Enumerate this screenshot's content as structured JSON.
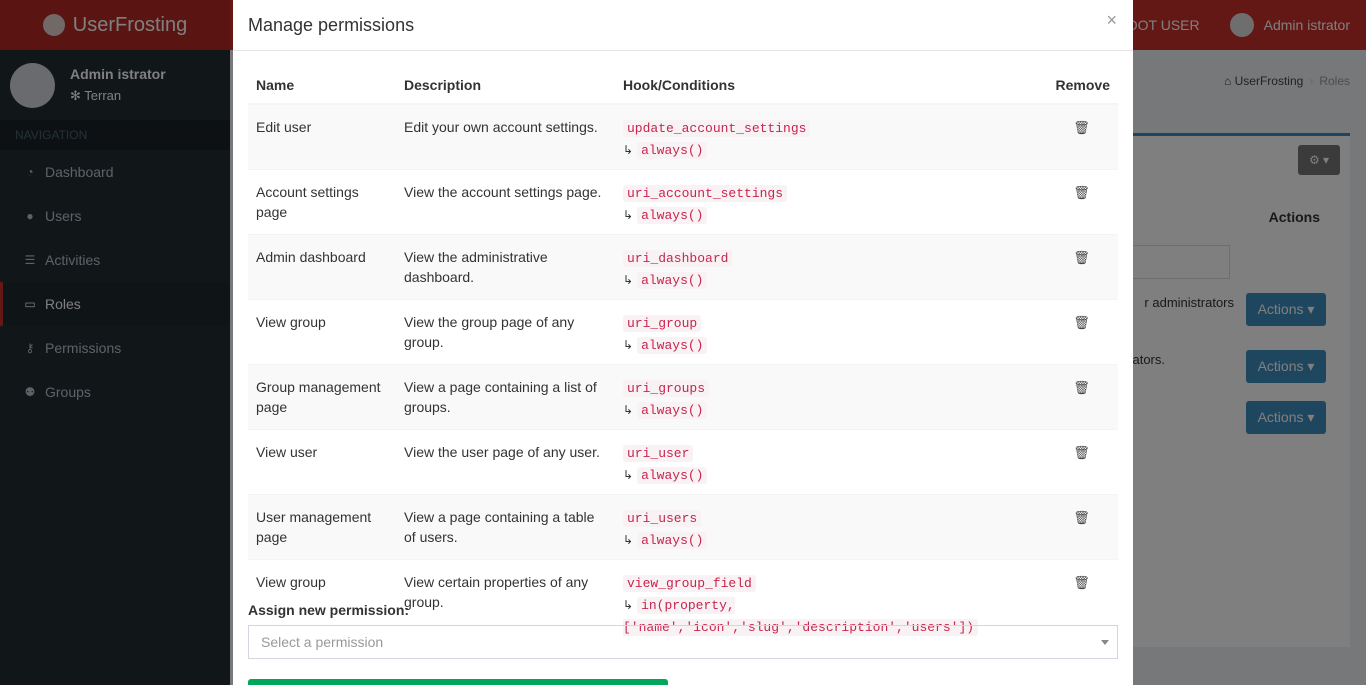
{
  "app": {
    "brand": "UserFrosting"
  },
  "topbar": {
    "root_label": "ROOT USER",
    "user_name": "Admin istrator"
  },
  "sidebar": {
    "user_name": "Admin istrator",
    "user_status": "Terran",
    "nav_header": "NAVIGATION",
    "items": [
      {
        "label": "Dashboard",
        "icon": "dashboard-icon",
        "glyph": "◔"
      },
      {
        "label": "Users",
        "icon": "user-icon",
        "glyph": "●"
      },
      {
        "label": "Activities",
        "icon": "list-icon",
        "glyph": "☰"
      },
      {
        "label": "Roles",
        "icon": "id-card-icon",
        "glyph": "▭"
      },
      {
        "label": "Permissions",
        "icon": "key-icon",
        "glyph": "⚷"
      },
      {
        "label": "Groups",
        "icon": "users-icon",
        "glyph": "⚉"
      }
    ]
  },
  "breadcrumb": {
    "home": "UserFrosting",
    "current": "Roles"
  },
  "background_table": {
    "actions_header": "Actions",
    "row1_text": "r administrators",
    "row2_text": "rators.",
    "action_label": "Actions ▾"
  },
  "modal": {
    "title": "Manage permissions",
    "close": "×",
    "columns": {
      "name": "Name",
      "description": "Description",
      "hook": "Hook/Conditions",
      "remove": "Remove"
    },
    "rows": [
      {
        "name": "Edit user",
        "description": "Edit your own account settings.",
        "hook": "update_account_settings",
        "condition": "always()"
      },
      {
        "name": "Account settings page",
        "description": "View the account settings page.",
        "hook": "uri_account_settings",
        "condition": "always()"
      },
      {
        "name": "Admin dashboard",
        "description": "View the administrative dashboard.",
        "hook": "uri_dashboard",
        "condition": "always()"
      },
      {
        "name": "View group",
        "description": "View the group page of any group.",
        "hook": "uri_group",
        "condition": "always()"
      },
      {
        "name": "Group management page",
        "description": "View a page containing a list of groups.",
        "hook": "uri_groups",
        "condition": "always()"
      },
      {
        "name": "View user",
        "description": "View the user page of any user.",
        "hook": "uri_user",
        "condition": "always()"
      },
      {
        "name": "User management page",
        "description": "View a page containing a table of users.",
        "hook": "uri_users",
        "condition": "always()"
      },
      {
        "name": "View group",
        "description": "View certain properties of any group.",
        "hook": "view_group_field",
        "condition": "in(property,['name','icon','slug','description','users'])"
      }
    ],
    "assign_label": "Assign new permission:",
    "select_placeholder": "Select a permission"
  },
  "colors": {
    "topbar": "#c9302c",
    "sidebar": "#222d32",
    "accent": "#3c8dbc",
    "code": "#c7254e",
    "submit": "#00a65a"
  }
}
